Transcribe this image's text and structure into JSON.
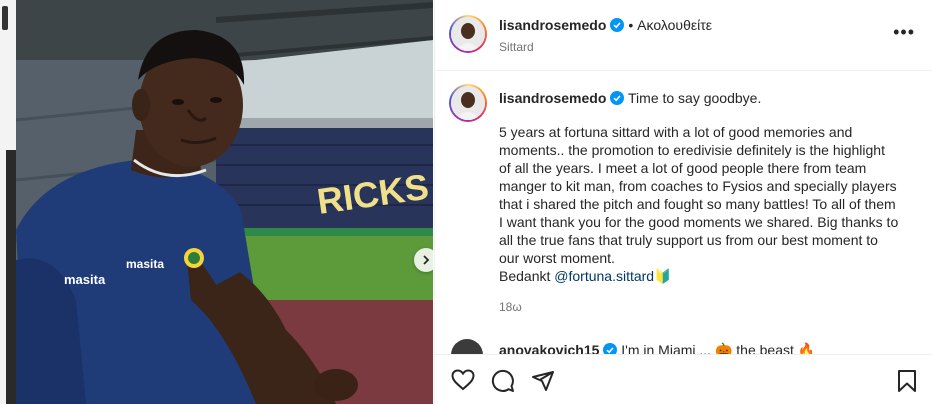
{
  "post": {
    "username": "lisandrosemedo",
    "follow_status": "• Ακολουθείτε",
    "location": "Sittard",
    "caption_first_line": "Time to say goodbye.",
    "caption_lines": [
      "5 years at fortuna sittard with a lot of good memories and",
      "moments.. the promotion to eredivisie definitely is the highlight",
      "of all the years. I meet a lot of good people there from team",
      "manger to kit man, from coaches to Fysios and specially players",
      "that i shared the pitch and fought so many battles! To all of them",
      "I want thank you for the good moments we shared. Big thanks to",
      "all the true fans that truly support us from our best moment to",
      "our worst moment."
    ],
    "sign_off": "Bedankt ",
    "mention": "@fortuna.sittard",
    "sign_off_emoji": "🔰",
    "timestamp": "18ω"
  },
  "comment": {
    "username": "anovakovich15",
    "text": "I'm in Miami ... 🎃 the beast 🔥"
  },
  "photo": {
    "jersey_sponsor": "masita",
    "stand_lettering": "RICKS"
  },
  "colors": {
    "verified": "#0095f6",
    "mention": "#00376b",
    "secondary_text": "#737373",
    "jersey": "#1f3b78"
  }
}
